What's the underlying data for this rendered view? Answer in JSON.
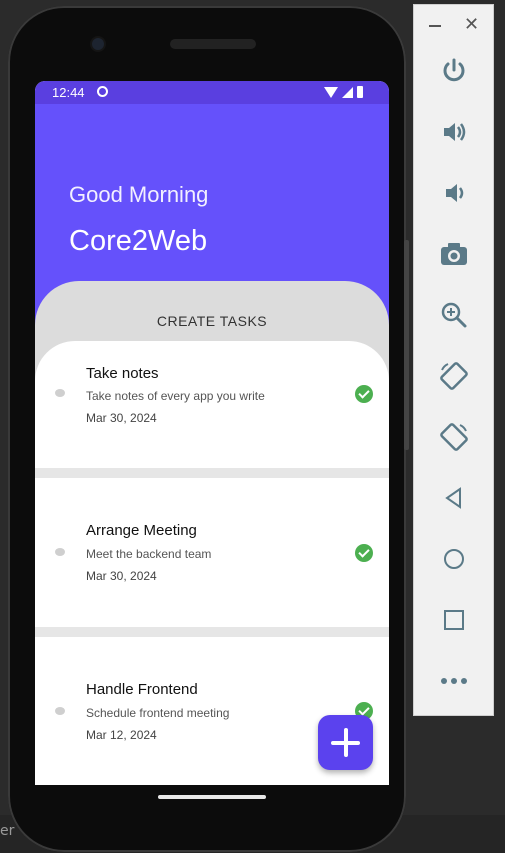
{
  "status_bar": {
    "time": "12:44"
  },
  "header": {
    "greeting": "Good Morning",
    "app_name": "Core2Web"
  },
  "section": {
    "label": "CREATE TASKS"
  },
  "tasks": [
    {
      "title": "Take notes",
      "description": "Take notes of every app you write",
      "date": "Mar 30, 2024",
      "completed": true
    },
    {
      "title": "Arrange Meeting",
      "description": "Meet the backend team",
      "date": "Mar 30, 2024",
      "completed": true
    },
    {
      "title": "Handle Frontend",
      "description": "Schedule frontend meeting",
      "date": "Mar 12, 2024",
      "completed": true
    }
  ],
  "fab": {
    "icon": "plus-icon"
  },
  "emulator_toolbar": {
    "window_controls": [
      "minimize-icon",
      "close-icon"
    ],
    "items": [
      "power-icon",
      "volume-up-icon",
      "volume-down-icon",
      "camera-icon",
      "zoom-icon",
      "rotate-left-icon",
      "rotate-right-icon",
      "back-icon",
      "home-icon",
      "overview-icon",
      "more-icon"
    ]
  },
  "colors": {
    "accent": "#6551fb",
    "fab": "#5b42ee",
    "check": "#4caf50",
    "panel": "#dcdcdc"
  },
  "desktop": {
    "left_edge_text": "er"
  }
}
